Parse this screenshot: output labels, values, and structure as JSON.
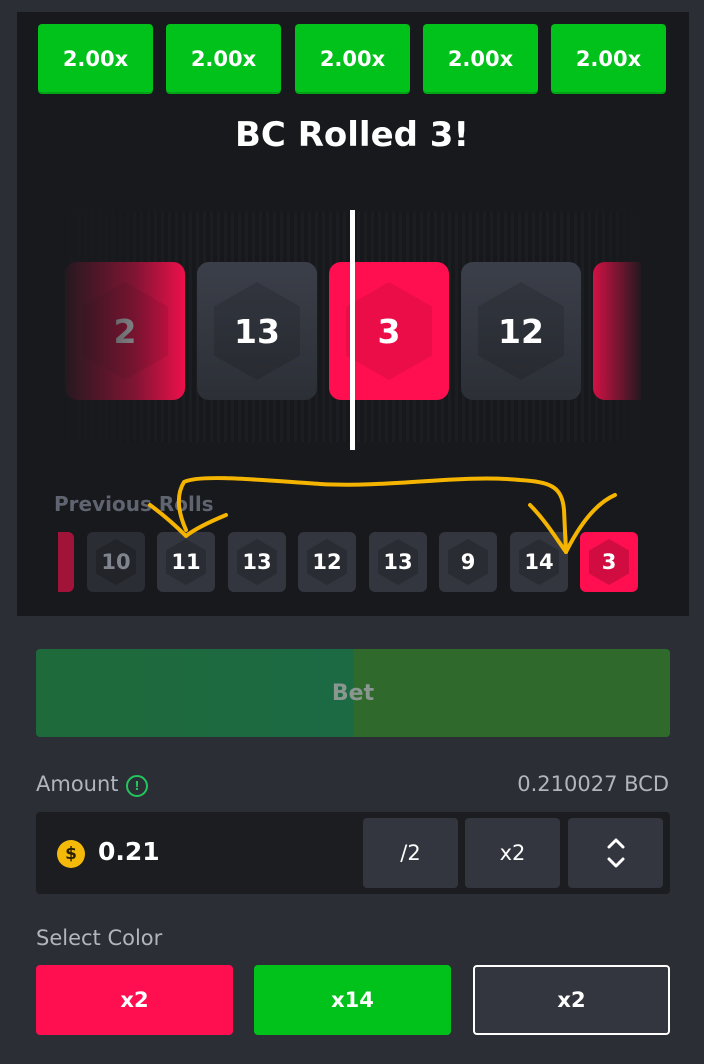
{
  "multipliers": [
    "2.00x",
    "2.00x",
    "2.00x",
    "2.00x",
    "2.00x"
  ],
  "title": "BC Rolled 3!",
  "reel": [
    {
      "value": "2",
      "color": "red"
    },
    {
      "value": "13",
      "color": "grey"
    },
    {
      "value": "3",
      "color": "red"
    },
    {
      "value": "12",
      "color": "grey"
    },
    {
      "value": "",
      "color": "red"
    }
  ],
  "previous_rolls_label": "Previous Rolls",
  "previous_rolls": [
    {
      "value": "",
      "color": "red"
    },
    {
      "value": "10",
      "color": "grey"
    },
    {
      "value": "11",
      "color": "grey"
    },
    {
      "value": "13",
      "color": "grey"
    },
    {
      "value": "12",
      "color": "grey"
    },
    {
      "value": "13",
      "color": "grey"
    },
    {
      "value": "9",
      "color": "grey"
    },
    {
      "value": "14",
      "color": "grey"
    },
    {
      "value": "3",
      "color": "red"
    }
  ],
  "bet_button": "Bet",
  "amount": {
    "label": "Amount",
    "info_icon": "!",
    "balance": "0.210027 BCD",
    "currency_icon": "$",
    "value": "0.21",
    "half_label": "/2",
    "double_label": "x2"
  },
  "select_color": {
    "label": "Select Color",
    "options": [
      "x2",
      "x14",
      "x2"
    ]
  },
  "colors": {
    "red": "#ff0f4f",
    "green": "#00c21a",
    "grey": "#33363e",
    "annotation": "#f5b400"
  }
}
